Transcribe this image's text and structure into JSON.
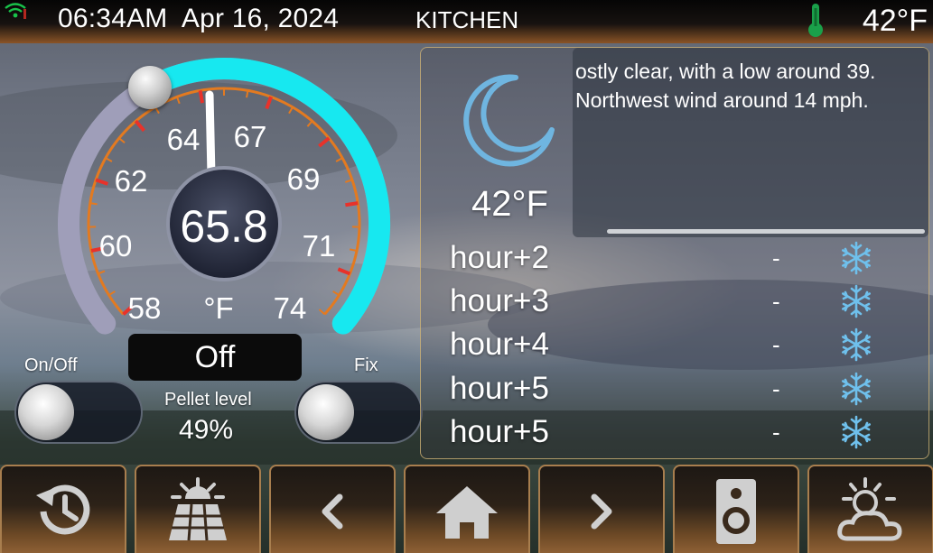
{
  "status_bar": {
    "time": "06:34AM",
    "date": "Apr 16, 2024",
    "room": "KITCHEN",
    "outside_temp": "42°F"
  },
  "stove": {
    "current_temp": "65.8",
    "unit": "°F",
    "scale_labels": [
      "58",
      "60",
      "62",
      "64",
      "67",
      "69",
      "71",
      "74"
    ],
    "setpoint_fraction": 0.39,
    "status": "Off",
    "on_off_label": "On/Off",
    "fix_label": "Fix",
    "pellet_label": "Pellet level",
    "pellet_value": "49%",
    "on_off_state": "off",
    "fix_state": "off"
  },
  "weather": {
    "current_temp": "42°F",
    "condition_icon": "moon-icon",
    "forecast_text": "ostly clear, with a low around 39.\nNorthwest wind around 14 mph.",
    "hours": [
      {
        "label": "hour+2",
        "value": "-",
        "icon": "snowflake-icon"
      },
      {
        "label": "hour+3",
        "value": "-",
        "icon": "snowflake-icon"
      },
      {
        "label": "hour+4",
        "value": "-",
        "icon": "snowflake-icon"
      },
      {
        "label": "hour+5",
        "value": "-",
        "icon": "snowflake-icon"
      },
      {
        "label": "hour+5",
        "value": "-",
        "icon": "snowflake-icon"
      }
    ]
  },
  "colors": {
    "accent_cyan": "#17e8f0",
    "gauge_orange": "#e37a20",
    "tick_red": "#e8322a",
    "nav_border": "#a87e4e"
  },
  "nav": [
    {
      "name": "history",
      "icon": "history-icon"
    },
    {
      "name": "solar",
      "icon": "solar-panel-icon"
    },
    {
      "name": "previous",
      "icon": "chevron-left-icon"
    },
    {
      "name": "home",
      "icon": "home-icon"
    },
    {
      "name": "next",
      "icon": "chevron-right-icon"
    },
    {
      "name": "speaker",
      "icon": "speaker-icon"
    },
    {
      "name": "weather",
      "icon": "weather-icon"
    }
  ]
}
